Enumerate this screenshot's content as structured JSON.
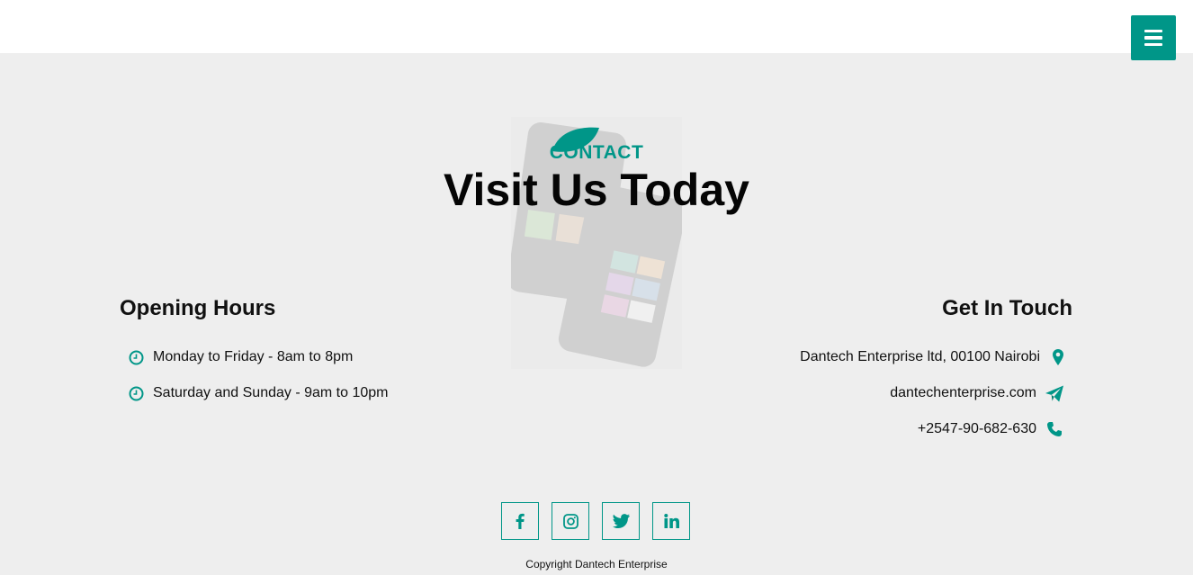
{
  "header": {
    "menu_icon": "hamburger-icon"
  },
  "colors": {
    "accent": "#009688",
    "background": "#eeeeee",
    "topbar": "#ffffff"
  },
  "contact": {
    "kicker": "CONTACT",
    "headline": "Visit Us Today"
  },
  "opening_hours": {
    "title": "Opening Hours",
    "items": [
      {
        "icon": "clock-icon",
        "text": "Monday to Friday - 8am to 8pm"
      },
      {
        "icon": "clock-icon",
        "text": "Saturday and Sunday - 9am to 10pm"
      }
    ]
  },
  "get_in_touch": {
    "title": "Get In Touch",
    "address": {
      "icon": "location-pin-icon",
      "text": "Dantech Enterprise ltd, 00100 Nairobi"
    },
    "website": {
      "icon": "paper-plane-icon",
      "text": "dantechenterprise.com"
    },
    "phone": {
      "icon": "phone-icon",
      "text": "+2547-90-682-630"
    }
  },
  "social": [
    "facebook-icon",
    "instagram-icon",
    "twitter-icon",
    "linkedin-icon"
  ],
  "footer": {
    "copyright": "Copyright Dantech Enterprise"
  }
}
